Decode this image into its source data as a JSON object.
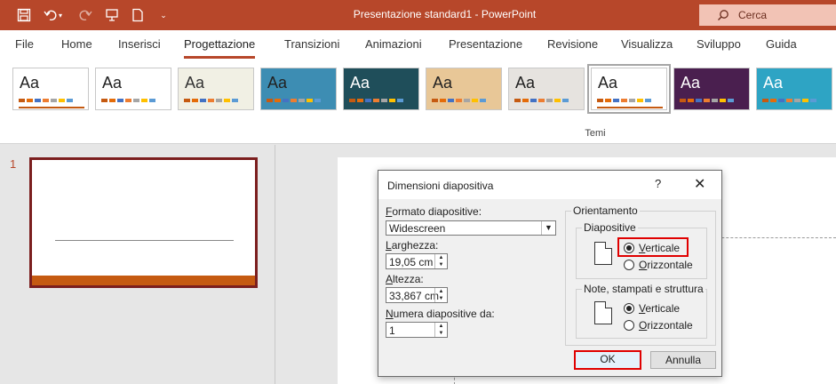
{
  "titlebar": {
    "title": "Presentazione standard1  -  PowerPoint",
    "search_placeholder": "Cerca",
    "qat": [
      "save-icon",
      "undo-icon",
      "redo-icon",
      "presenter-icon",
      "new-doc-icon",
      "customize-icon"
    ]
  },
  "tabs": [
    "File",
    "Home",
    "Inserisci",
    "Progettazione",
    "Transizioni",
    "Animazioni",
    "Presentazione",
    "Revisione",
    "Visualizza",
    "Sviluppo",
    "Guida"
  ],
  "active_tab": "Progettazione",
  "ribbon": {
    "themes": [
      {
        "label": "Aa",
        "bg": "#ffffff",
        "fg": "#222222",
        "bar": "#c55a11"
      },
      {
        "label": "Aa",
        "bg": "#ffffff",
        "fg": "#222222",
        "bar": "#ffffff"
      },
      {
        "label": "Aa",
        "bg": "#f1f0e4",
        "fg": "#333333",
        "bar": "#f1f0e4"
      },
      {
        "label": "Aa",
        "bg": "#3d8db3",
        "fg": "#222222",
        "bar": "#3d8db3"
      },
      {
        "label": "Aa",
        "bg": "#1f4e5a",
        "fg": "#ffffff",
        "bar": "#1f4e5a"
      },
      {
        "label": "Aa",
        "bg": "#e8c797",
        "fg": "#222222",
        "bar": "#e8c797"
      },
      {
        "label": "Aa",
        "bg": "#e6e3df",
        "fg": "#222222",
        "bar": "#e6e3df"
      },
      {
        "label": "Aa",
        "bg": "#ffffff",
        "fg": "#222222",
        "bar": "#c55a11"
      },
      {
        "label": "Aa",
        "bg": "#4a1f4f",
        "fg": "#ffffff",
        "bar": "#4a1f4f"
      },
      {
        "label": "Aa",
        "bg": "#2ea4c4",
        "fg": "#ffffff",
        "bar": "#2ea4c4"
      }
    ],
    "group_label": "Temi"
  },
  "slides_panel": {
    "slide_number": "1"
  },
  "dialog": {
    "title": "Dimensioni diapositiva",
    "help": "?",
    "close": "✕",
    "format_label_u": "F",
    "format_label_rest": "ormato diapositive:",
    "format_value": "Widescreen",
    "width_label_u": "L",
    "width_label_rest": "arghezza:",
    "width_value": "19,05 cm",
    "height_label_u": "A",
    "height_label_rest": "ltezza:",
    "height_value": "33,867 cm",
    "number_label_u": "N",
    "number_label_rest": "umera diapositive da:",
    "number_value": "1",
    "orientation_label": "Orientamento",
    "slides_group_label": "Diapositive",
    "slides_vertical_u": "V",
    "slides_vertical_rest": "erticale",
    "slides_horizontal_u": "O",
    "slides_horizontal_rest": "rizzontale",
    "notes_group_label": "Note, stampati e struttura",
    "notes_vertical_u": "V",
    "notes_vertical_rest": "erticale",
    "notes_horizontal_u": "O",
    "notes_horizontal_rest": "rizzontale",
    "ok_label": "OK",
    "cancel_label": "Annulla"
  }
}
